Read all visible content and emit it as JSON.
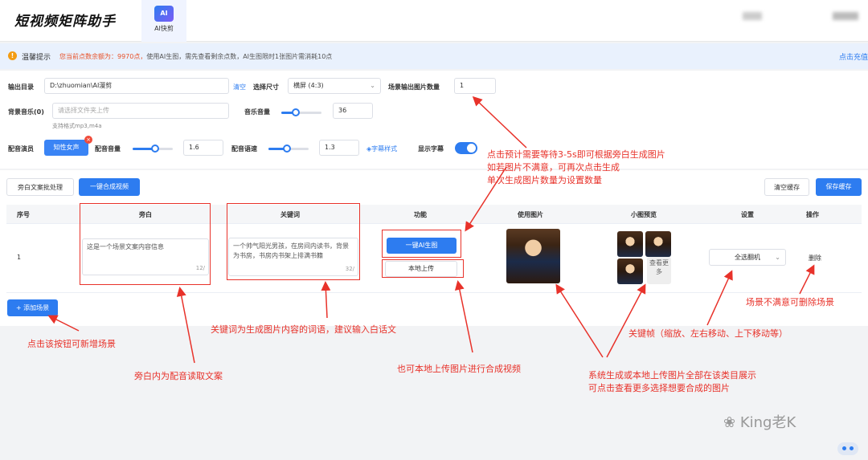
{
  "app": {
    "logo": "短视频矩阵助手",
    "tab_icon": "AI",
    "tab_label": "AI快剪"
  },
  "notice": {
    "title": "温馨提示",
    "text_red": "您当前点数余额为：9970点，",
    "text_rest": "使用AI生图，需先查看剩余点数，AI生图限时1张图片需消耗10点",
    "recharge": "点击充值"
  },
  "form": {
    "output_dir_label": "输出目录",
    "output_dir_value": "D:\\zhuomian\\AI漫剪",
    "clear_label": "清空",
    "size_label": "选择尺寸",
    "size_value": "横屏 (4:3)",
    "count_label": "场景输出图片数量",
    "count_value": "1",
    "music_label": "背景音乐(0)",
    "music_placeholder": "请选择文件夹上传",
    "music_hint": "支持格式mp3,m4a",
    "music_volume_label": "音乐音量",
    "music_volume_value": "36",
    "music_volume_level": 0.36,
    "actor_label": "配音演员",
    "actor_value": "知性女声",
    "dub_volume_label": "配音音量",
    "dub_volume_value": "1.6",
    "dub_volume_level": 0.55,
    "speed_label": "配音语速",
    "speed_value": "1.3",
    "speed_level": 0.45,
    "subtitle_style": "字幕样式",
    "show_subtitle_label": "显示字幕",
    "show_subtitle_on": true
  },
  "actions": {
    "batch": "旁白文案批处理",
    "compose": "一键合成视频",
    "clear_cache": "清空缓存",
    "save_cache": "保存缓存",
    "add_scene": "+ 添加场景"
  },
  "table": {
    "headers": [
      "序号",
      "旁白",
      "关键词",
      "功能",
      "使用图片",
      "小图预览",
      "设置",
      "操作"
    ],
    "rows": [
      {
        "index": "1",
        "narration": "这是一个场景文案内容信息",
        "narration_count": "12/",
        "keywords": "一个帅气阳光男孩，在房间内读书，背景为书房，书房内书架上排满书籍",
        "keywords_count": "32/",
        "ai_button": "一键AI生图",
        "upload_button": "本地上传",
        "more": "查看更多",
        "setting": "全选翻机",
        "delete": "删除"
      }
    ]
  },
  "annotations": {
    "top": "点击预计需要等待3-5s即可根据旁白生成图片\n如若图片不满意，可再次点击生成\n单次生成图片数量为设置数量",
    "add_scene": "点击该按钮可新增场景",
    "keywords": "关键词为生成图片内容的词语，建议输入白话文",
    "narration": "旁白内为配音读取文案",
    "upload": "也可本地上传图片进行合成视频",
    "keyframe": "关键帧（缩放、左右移动、上下移动等）",
    "delete": "场景不满意可删除场景",
    "preview": "系统生成或本地上传图片全部在该类目展示\n可点击查看更多选择想要合成的图片"
  },
  "watermark": "King老K",
  "colors": {
    "primary": "#2d7cf0",
    "annotation_red": "#e8322a",
    "warning": "#f39c12"
  }
}
